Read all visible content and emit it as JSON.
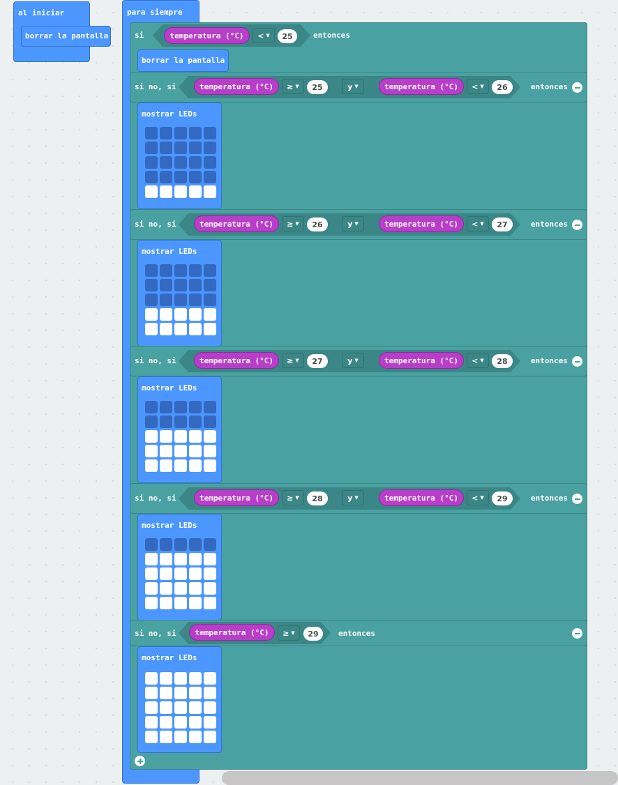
{
  "on_start": {
    "label": "al iniciar",
    "statement": "borrar la pantalla"
  },
  "forever": {
    "label": "para siempre",
    "if_block": {
      "if_label": "si",
      "then_label": "entonces",
      "condition": {
        "reporter": "temperatura (°C)",
        "operator": "<",
        "value": "25"
      },
      "body": "borrar la pantalla"
    },
    "else_if_label": "si no, si",
    "and_label": "y",
    "show_leds_label": "mostrar LEDs",
    "branches": [
      {
        "lo_op": "≥",
        "lo": "25",
        "hi_op": "<",
        "hi": "26",
        "lit_rows": 1
      },
      {
        "lo_op": "≥",
        "lo": "26",
        "hi_op": "<",
        "hi": "27",
        "lit_rows": 2
      },
      {
        "lo_op": "≥",
        "lo": "27",
        "hi_op": "<",
        "hi": "28",
        "lit_rows": 3
      },
      {
        "lo_op": "≥",
        "lo": "28",
        "hi_op": "<",
        "hi": "29",
        "lit_rows": 4
      }
    ],
    "last_branch": {
      "reporter": "temperatura (°C)",
      "op": "≥",
      "value": "29",
      "lit_rows": 5
    }
  },
  "colors": {
    "loops_blue": "#4c97ff",
    "logic_teal": "#4aa1a1",
    "input_magenta": "#b83ec9",
    "led_off": "#3369c0",
    "led_on": "#ffffff"
  },
  "icons": [
    "minus-icon",
    "plus-icon",
    "dropdown-caret-icon"
  ]
}
